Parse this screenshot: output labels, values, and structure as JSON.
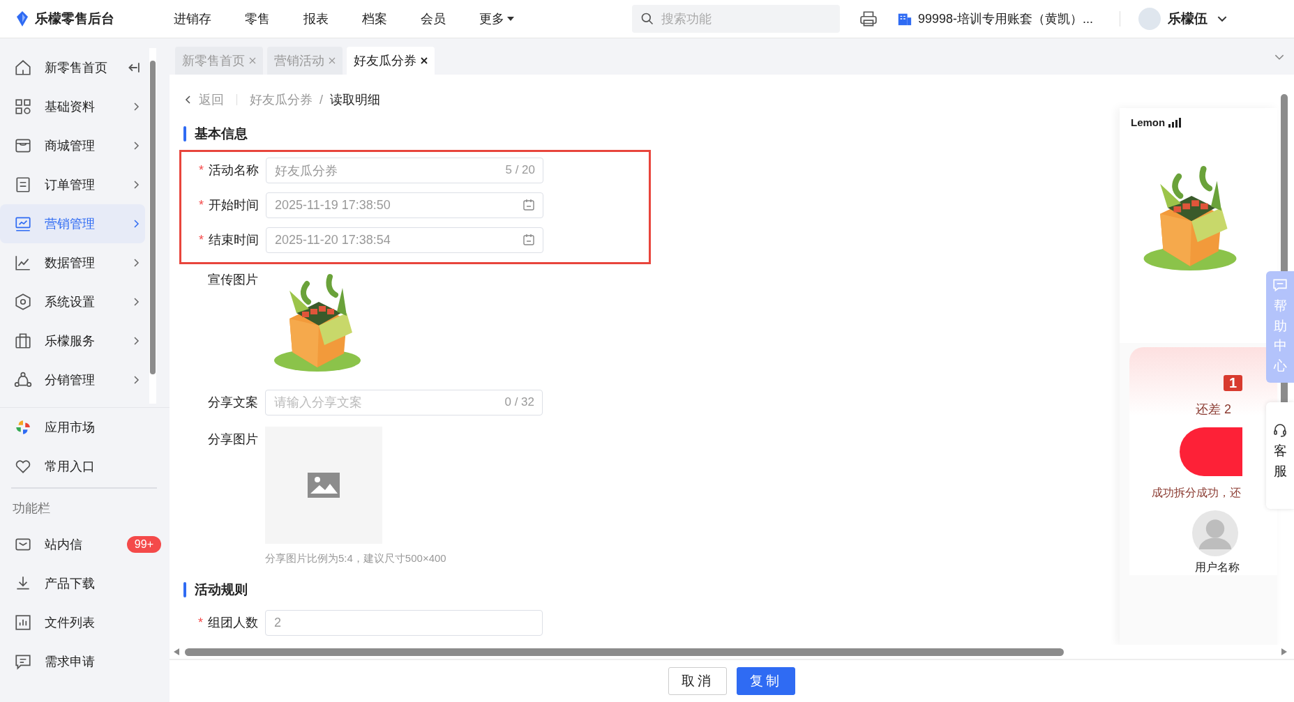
{
  "app": {
    "title": "乐檬零售后台"
  },
  "top_nav": [
    {
      "label": "进销存"
    },
    {
      "label": "零售"
    },
    {
      "label": "报表"
    },
    {
      "label": "档案"
    },
    {
      "label": "会员"
    }
  ],
  "more_menu": {
    "label": "更多"
  },
  "search": {
    "placeholder": "搜索功能"
  },
  "account": {
    "label": "99998-培训专用账套（黄凯）..."
  },
  "user": {
    "name": "乐檬伍"
  },
  "sidebar": {
    "items": [
      {
        "label": "新零售首页",
        "selected": false,
        "expandable": false
      },
      {
        "label": "基础资料",
        "selected": false,
        "expandable": true
      },
      {
        "label": "商城管理",
        "selected": false,
        "expandable": true
      },
      {
        "label": "订单管理",
        "selected": false,
        "expandable": true
      },
      {
        "label": "营销管理",
        "selected": true,
        "expandable": true
      },
      {
        "label": "数据管理",
        "selected": false,
        "expandable": true
      },
      {
        "label": "系统设置",
        "selected": false,
        "expandable": true
      },
      {
        "label": "乐檬服务",
        "selected": false,
        "expandable": true
      },
      {
        "label": "分销管理",
        "selected": false,
        "expandable": true
      }
    ],
    "shortcuts": [
      {
        "label": "应用市场"
      },
      {
        "label": "常用入口"
      }
    ],
    "section_label": "功能栏",
    "tools": [
      {
        "label": "站内信",
        "badge": "99+"
      },
      {
        "label": "产品下载"
      },
      {
        "label": "文件列表"
      },
      {
        "label": "需求申请"
      }
    ]
  },
  "tabs": [
    {
      "label": "新零售首页",
      "selected": false
    },
    {
      "label": "营销活动",
      "selected": false
    },
    {
      "label": "好友瓜分券",
      "selected": true
    }
  ],
  "breadcrumb": {
    "back": "返回",
    "separator": "/",
    "path": [
      "好友瓜分券",
      "读取明细"
    ]
  },
  "required_mark": "*",
  "sections": [
    {
      "title": "基本信息",
      "fields": [
        {
          "kind": "text",
          "label": "活动名称",
          "required": true,
          "highlighted": true,
          "value": "好友瓜分券",
          "counter": "5 / 20"
        },
        {
          "kind": "date",
          "label": "开始时间",
          "required": true,
          "highlighted": true,
          "value": "2025-11-19 17:38:50"
        },
        {
          "kind": "date",
          "label": "结束时间",
          "required": true,
          "highlighted": true,
          "value": "2025-11-20 17:38:54"
        },
        {
          "kind": "image",
          "label": "宣传图片",
          "required": false,
          "highlighted": false
        },
        {
          "kind": "text",
          "label": "分享文案",
          "required": false,
          "highlighted": false,
          "placeholder": "请输入分享文案",
          "counter": "0 / 32"
        },
        {
          "kind": "upload",
          "label": "分享图片",
          "required": false,
          "highlighted": false,
          "hint": "分享图片比例为5:4，建议尺寸500×400"
        }
      ]
    },
    {
      "title": "活动规则",
      "fields": [
        {
          "kind": "text",
          "label": "组团人数",
          "required": true,
          "highlighted": false,
          "value": "2"
        }
      ]
    }
  ],
  "preview": {
    "brand": "Lemon",
    "badge": "1",
    "progress_text": "还差 2",
    "note": "成功拆分成功，还",
    "user_name": "用户名称"
  },
  "help_center": {
    "label": "帮助中心"
  },
  "service": {
    "label": "客服"
  },
  "footer_buttons": [
    {
      "label": "取消",
      "kind": "secondary"
    },
    {
      "label": "复制",
      "kind": "primary"
    }
  ]
}
